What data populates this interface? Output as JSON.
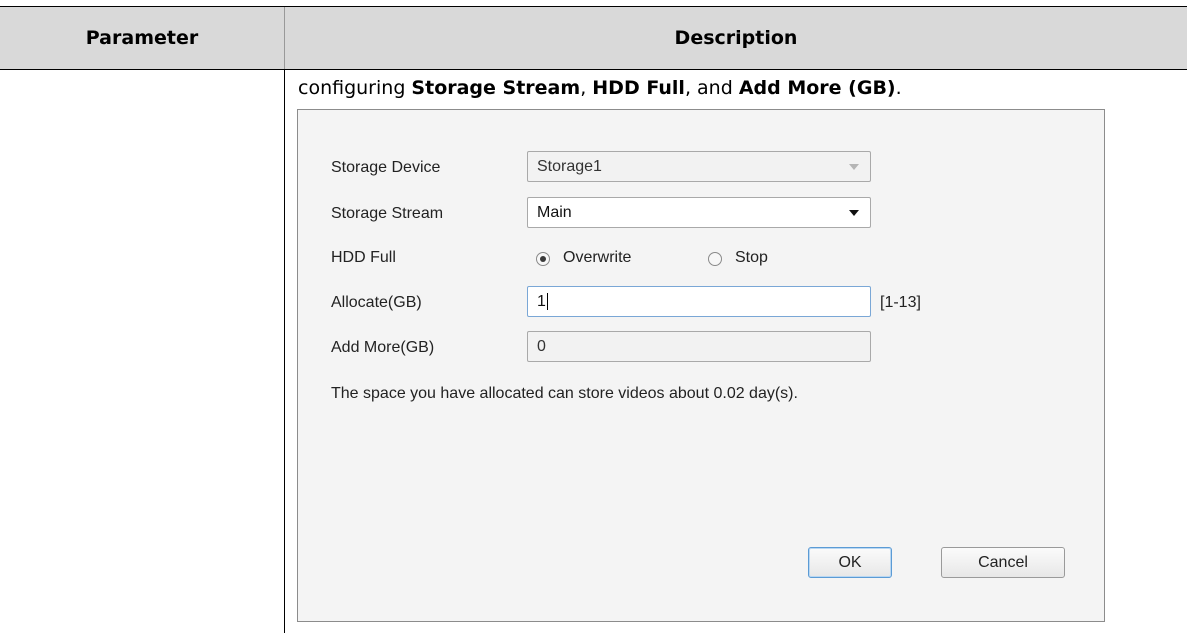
{
  "table": {
    "headers": {
      "parameter": "Parameter",
      "description": "Description"
    },
    "intro": {
      "prefix": "configuring ",
      "term1": "Storage Stream",
      "sep1": ", ",
      "term2": "HDD Full",
      "sep2": ", and ",
      "term3": "Add More (GB)",
      "suffix": "."
    }
  },
  "dialog": {
    "storage_device": {
      "label": "Storage Device",
      "value": "Storage1",
      "disabled": true
    },
    "storage_stream": {
      "label": "Storage Stream",
      "value": "Main"
    },
    "hdd_full": {
      "label": "HDD Full",
      "options": [
        {
          "label": "Overwrite",
          "selected": true
        },
        {
          "label": "Stop",
          "selected": false
        }
      ]
    },
    "allocate": {
      "label": "Allocate(GB)",
      "value": "1",
      "range": "[1-13]"
    },
    "add_more": {
      "label": "Add More(GB)",
      "value": "0",
      "disabled": true
    },
    "note": "The space you have allocated can store videos about 0.02 day(s).",
    "buttons": {
      "ok": "OK",
      "cancel": "Cancel"
    }
  }
}
